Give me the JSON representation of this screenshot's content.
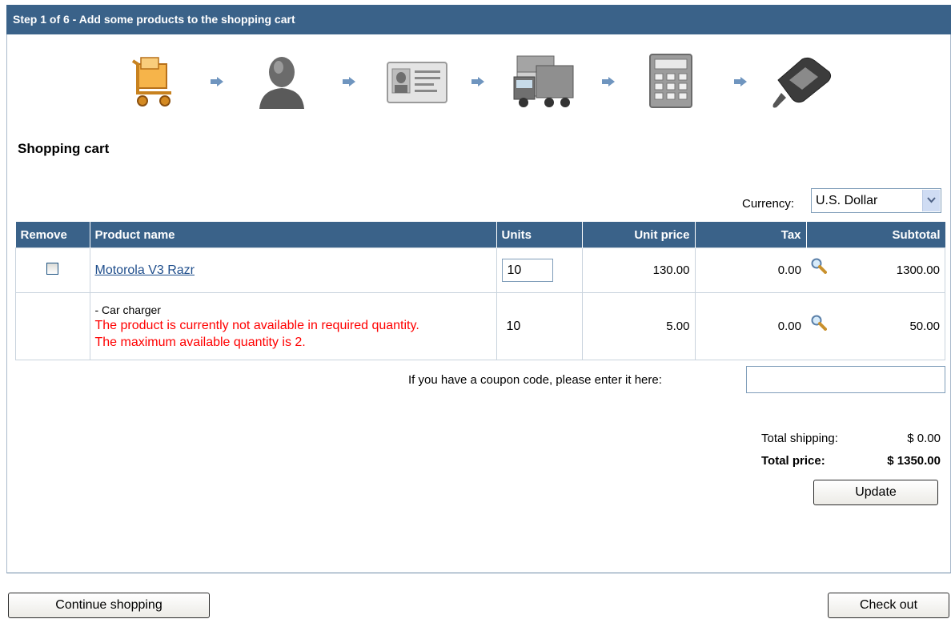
{
  "header": {
    "step_text": "Step 1 of 6 - Add some products to the shopping cart"
  },
  "steps": [
    {
      "icon": "shopping-cart-icon"
    },
    {
      "icon": "user-icon"
    },
    {
      "icon": "id-card-icon"
    },
    {
      "icon": "delivery-truck-icon"
    },
    {
      "icon": "calculator-icon"
    },
    {
      "icon": "payment-card-reader-icon"
    }
  ],
  "cart": {
    "title": "Shopping cart",
    "currency_label": "Currency:",
    "currency_value": "U.S. Dollar",
    "columns": {
      "remove": "Remove",
      "product": "Product name",
      "units": "Units",
      "unit_price": "Unit price",
      "tax": "Tax",
      "subtotal": "Subtotal"
    },
    "rows": [
      {
        "product": "Motorola V3 Razr",
        "units": "10",
        "unit_price": "130.00",
        "tax": "0.00",
        "subtotal": "1300.00"
      },
      {
        "product": "- Car charger",
        "warning_line1": "The product is currently not available in required quantity.",
        "warning_line2": "The maximum available quantity is 2.",
        "units": "10",
        "unit_price": "5.00",
        "tax": "0.00",
        "subtotal": "50.00"
      }
    ],
    "coupon_label": "If you have a coupon code, please enter it here:",
    "coupon_value": "",
    "total_shipping_label": "Total shipping:",
    "total_shipping_value": "$ 0.00",
    "total_price_label": "Total price:",
    "total_price_value": "$ 1350.00",
    "update_label": "Update"
  },
  "footer": {
    "continue_label": "Continue shopping",
    "checkout_label": "Check out"
  },
  "colors": {
    "header_bg": "#3a6289",
    "warning": "#ff0000",
    "link": "#1f4e8c"
  }
}
